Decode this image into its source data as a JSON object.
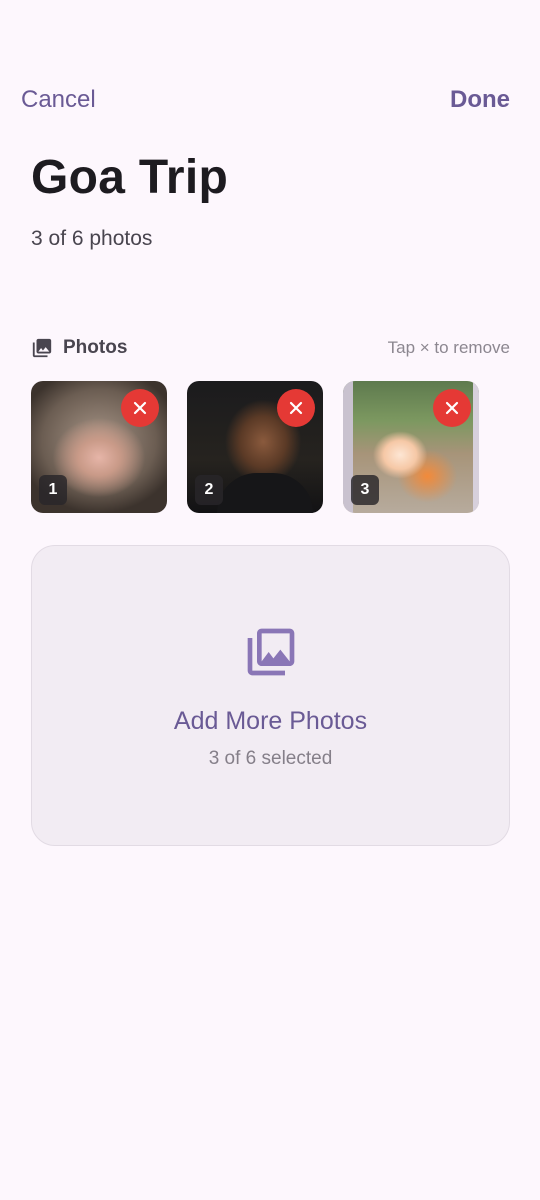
{
  "topbar": {
    "cancel_label": "Cancel",
    "done_label": "Done"
  },
  "album": {
    "title": "Goa Trip",
    "count_text": "3 of 6 photos"
  },
  "photos_section": {
    "label": "Photos",
    "icon": "photo-library-icon",
    "hint": "Tap × to remove"
  },
  "thumbnails": [
    {
      "index": "1",
      "remove_icon": "close-icon"
    },
    {
      "index": "2",
      "remove_icon": "close-icon"
    },
    {
      "index": "3",
      "remove_icon": "close-icon"
    }
  ],
  "add_card": {
    "icon": "photo-library-icon",
    "title": "Add More Photos",
    "subtitle": "3 of 6 selected"
  },
  "colors": {
    "background": "#fdf7fd",
    "accent": "#6a5a95",
    "remove_red": "#e53935",
    "card_bg": "#f2ecf3"
  }
}
